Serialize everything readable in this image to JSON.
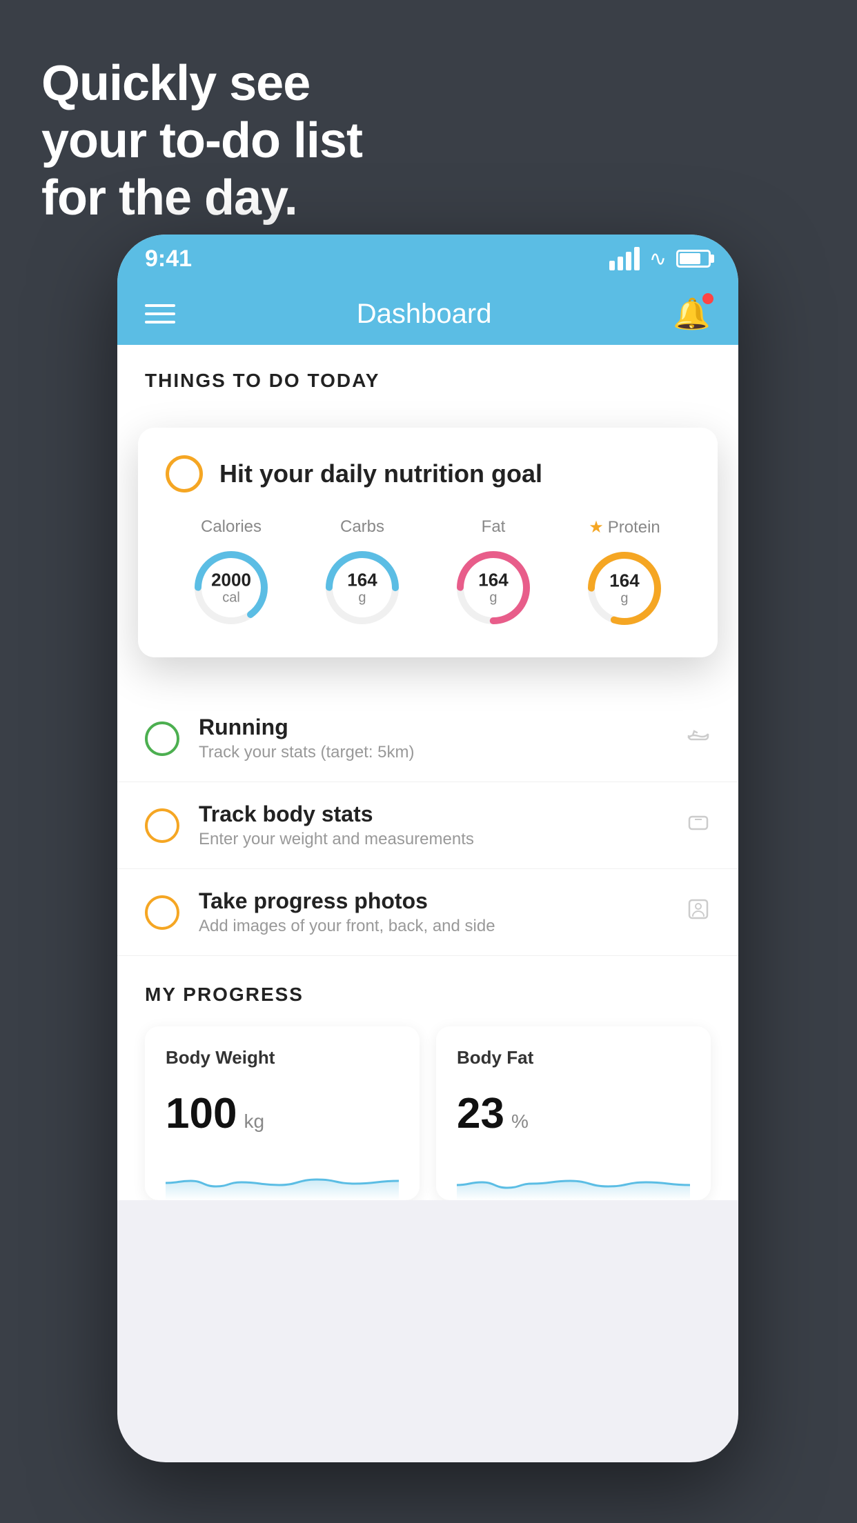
{
  "hero": {
    "line1": "Quickly see",
    "line2": "your to-do list",
    "line3": "for the day."
  },
  "statusBar": {
    "time": "9:41"
  },
  "navbar": {
    "title": "Dashboard"
  },
  "section": {
    "title": "THINGS TO DO TODAY"
  },
  "floatingCard": {
    "circleColor": "#f5a623",
    "title": "Hit your daily nutrition goal",
    "nutrients": [
      {
        "label": "Calories",
        "value": "2000",
        "unit": "cal",
        "color": "#5bbde4",
        "progress": 0.65
      },
      {
        "label": "Carbs",
        "value": "164",
        "unit": "g",
        "color": "#5bbde4",
        "progress": 0.5
      },
      {
        "label": "Fat",
        "value": "164",
        "unit": "g",
        "color": "#e85d8a",
        "progress": 0.75
      },
      {
        "label": "Protein",
        "value": "164",
        "unit": "g",
        "color": "#f5a623",
        "progress": 0.8,
        "starred": true
      }
    ]
  },
  "todoItems": [
    {
      "title": "Running",
      "subtitle": "Track your stats (target: 5km)",
      "circleColor": "green",
      "icon": "shoe"
    },
    {
      "title": "Track body stats",
      "subtitle": "Enter your weight and measurements",
      "circleColor": "yellow",
      "icon": "scale"
    },
    {
      "title": "Take progress photos",
      "subtitle": "Add images of your front, back, and side",
      "circleColor": "yellow",
      "icon": "person"
    }
  ],
  "progress": {
    "title": "MY PROGRESS",
    "cards": [
      {
        "title": "Body Weight",
        "value": "100",
        "unit": "kg"
      },
      {
        "title": "Body Fat",
        "value": "23",
        "unit": "%"
      }
    ]
  }
}
